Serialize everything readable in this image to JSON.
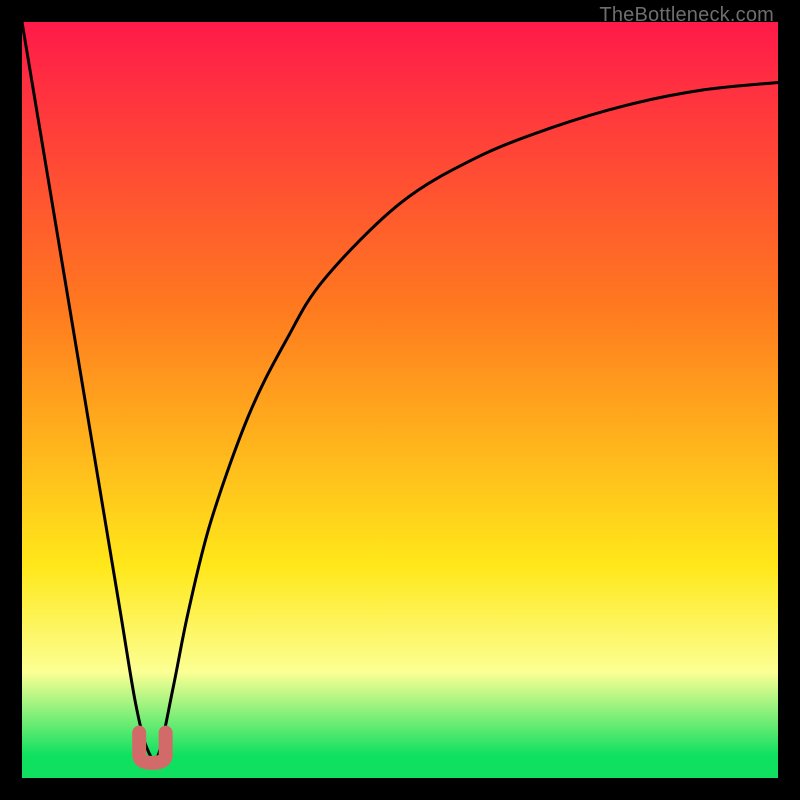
{
  "attribution": "TheBottleneck.com",
  "colors": {
    "red": "#ff1a4a",
    "orange": "#ff7a1f",
    "yellow": "#ffe81a",
    "pale": "#fcff94",
    "green": "#10e060",
    "black": "#000000",
    "curve": "#000000",
    "marker": "#d36a6a"
  },
  "chart_data": {
    "type": "line",
    "title": "",
    "xlabel": "",
    "ylabel": "",
    "xlim": [
      0,
      100
    ],
    "ylim": [
      0,
      100
    ],
    "grid": false,
    "series": [
      {
        "name": "bottleneck-curve",
        "x": [
          0,
          5,
          10,
          13,
          15,
          16.5,
          18,
          20,
          22,
          25,
          30,
          35,
          40,
          50,
          60,
          70,
          80,
          90,
          100
        ],
        "values": [
          100,
          70,
          40,
          22,
          10,
          4,
          3,
          12,
          22,
          34,
          48,
          58,
          66,
          76,
          82,
          86,
          89,
          91,
          92
        ]
      }
    ],
    "marker": {
      "name": "optimal-point",
      "shape": "u",
      "x_left": 15.5,
      "x_right": 19.0,
      "y_top": 6,
      "y_bottom": 2
    },
    "background_gradient": {
      "stops": [
        {
          "pos": 0.0,
          "color": "#ff1a4a"
        },
        {
          "pos": 0.38,
          "color": "#ff7a1f"
        },
        {
          "pos": 0.72,
          "color": "#ffe81a"
        },
        {
          "pos": 0.86,
          "color": "#fcff94"
        },
        {
          "pos": 0.97,
          "color": "#10e060"
        }
      ]
    }
  }
}
